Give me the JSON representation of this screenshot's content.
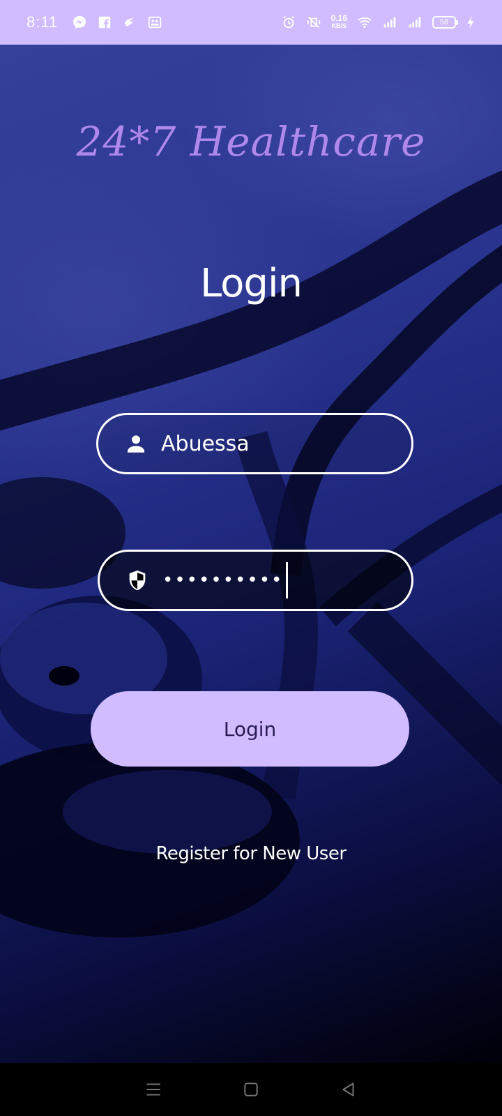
{
  "status_bar": {
    "time": "8:11",
    "left_icons": [
      "messenger-icon",
      "facebook-icon",
      "messenger-lite-icon",
      "app-notification-icon"
    ],
    "right_icons": [
      "alarm-icon",
      "vibrate-off-icon",
      "wifi-icon",
      "signal-icon",
      "signal-icon",
      "battery-icon",
      "charging-icon"
    ],
    "net_speed": "0.16",
    "net_speed_unit": "KB/S",
    "battery": "58"
  },
  "app": {
    "title": "24*7 Healthcare",
    "heading": "Login"
  },
  "form": {
    "username": {
      "value": "Abuessa",
      "icon": "person-icon"
    },
    "password": {
      "value": "••••••••••",
      "icon": "shield-icon"
    },
    "login_label": "Login",
    "register_label": "Register for New User"
  },
  "nav_bar": {
    "buttons": [
      "menu-icon",
      "home-icon",
      "back-icon"
    ]
  },
  "colors": {
    "accent": "#d0bcff",
    "title": "#b088ec",
    "background_dark": "#1c2478"
  }
}
